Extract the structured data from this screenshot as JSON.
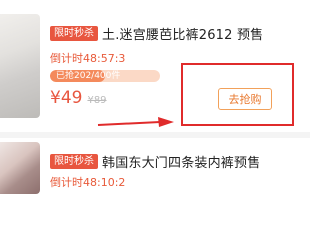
{
  "items": [
    {
      "badge": "限时秒杀",
      "title": "土.迷宫腰芭比裤2612 预售",
      "countdown": "倒计时48:57:3",
      "progress_label": "已抢202/400件",
      "progress_fraction": 0.5,
      "price_now": "¥49",
      "price_old": "¥89",
      "action_label": "去抢购"
    },
    {
      "badge": "限时秒杀",
      "title": "韩国东大门四条装内裤预售",
      "countdown": "倒计时48:10:2"
    }
  ],
  "colors": {
    "accent": "#e8563f",
    "annotation": "#e02b2b",
    "button_border": "#f2a15a"
  },
  "icons": [
    "product-thumbnail",
    "annotation-arrow"
  ]
}
